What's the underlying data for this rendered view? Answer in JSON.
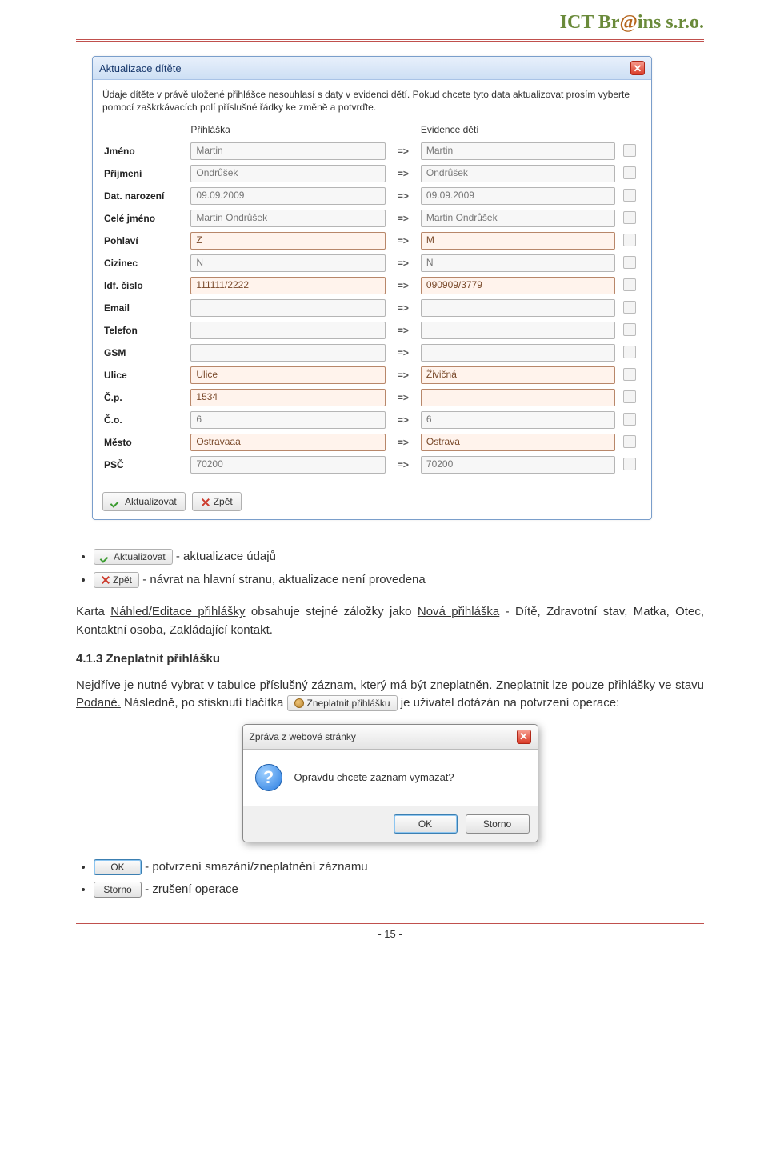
{
  "logo": "ICT Br@ins s.r.o.",
  "dialog": {
    "title": "Aktualizace dítěte",
    "intro": "Údaje dítěte v právě uložené přihlášce nesouhlasí s daty v evidenci dětí. Pokud chcete tyto data aktualizovat prosím vyberte pomocí zaškrkávacích polí příslušné řádky ke změně a potvrďte.",
    "col_form": "Přihláška",
    "col_evidence": "Evidence dětí",
    "arrow": "=>",
    "rows": [
      {
        "label": "Jméno",
        "a": "Martin",
        "b": "Martin",
        "hl": false
      },
      {
        "label": "Příjmení",
        "a": "Ondrůšek",
        "b": "Ondrůšek",
        "hl": false
      },
      {
        "label": "Dat. narození",
        "a": "09.09.2009",
        "b": "09.09.2009",
        "hl": false
      },
      {
        "label": "Celé jméno",
        "a": "Martin Ondrůšek",
        "b": "Martin Ondrůšek",
        "hl": false
      },
      {
        "label": "Pohlaví",
        "a": "Z",
        "b": "M",
        "hl": true
      },
      {
        "label": "Cizinec",
        "a": "N",
        "b": "N",
        "hl": false
      },
      {
        "label": "Idf. číslo",
        "a": "111111/2222",
        "b": "090909/3779",
        "hl": true
      },
      {
        "label": "Email",
        "a": "",
        "b": "",
        "hl": false
      },
      {
        "label": "Telefon",
        "a": "",
        "b": "",
        "hl": false
      },
      {
        "label": "GSM",
        "a": "",
        "b": "",
        "hl": false
      },
      {
        "label": "Ulice",
        "a": "Ulice",
        "b": "Živičná",
        "hl": true
      },
      {
        "label": "Č.p.",
        "a": "1534",
        "b": "",
        "hl": true
      },
      {
        "label": "Č.o.",
        "a": "6",
        "b": "6",
        "hl": false
      },
      {
        "label": "Město",
        "a": "Ostravaaa",
        "b": "Ostrava",
        "hl": true
      },
      {
        "label": "PSČ",
        "a": "70200",
        "b": "70200",
        "hl": false
      }
    ],
    "btn_update": "Aktualizovat",
    "btn_back": "Zpět"
  },
  "doc": {
    "bullet1_btn": "Aktualizovat",
    "bullet1_text": " - aktualizace údajů",
    "bullet2_btn": "Zpět",
    "bullet2_text": " - návrat na hlavní stranu, aktualizace není provedena",
    "para1_a": "Karta ",
    "para1_link1": "Náhled/Editace přihlášky",
    "para1_b": " obsahuje stejné záložky jako ",
    "para1_link2": "Nová přihláška",
    "para1_c": " - Dítě, Zdravotní stav, Matka, Otec, Kontaktní osoba, Zakládající kontakt.",
    "heading": "4.1.3 Zneplatnit přihlášku",
    "para2_a": "Nejdříve je nutné vybrat v tabulce příslušný záznam, který má být zneplatněn. ",
    "para2_link": "Zneplatnit lze pouze přihlášky ve stavu Podané.",
    "para2_b": " Následně, po stisknutí tlačítka ",
    "inline_btn": "Zneplatnit přihlášku",
    "para2_c": " je uživatel dotázán na potvrzení operace:",
    "confirm_title": "Zpráva z webové stránky",
    "confirm_msg": "Opravdu chcete zaznam vymazat?",
    "confirm_ok": "OK",
    "confirm_cancel": "Storno",
    "bullet3_btn": "OK",
    "bullet3_text": " - potvrzení smazání/zneplatnění záznamu",
    "bullet4_btn": "Storno",
    "bullet4_text": " - zrušení operace",
    "page_num": "- 15 -"
  }
}
